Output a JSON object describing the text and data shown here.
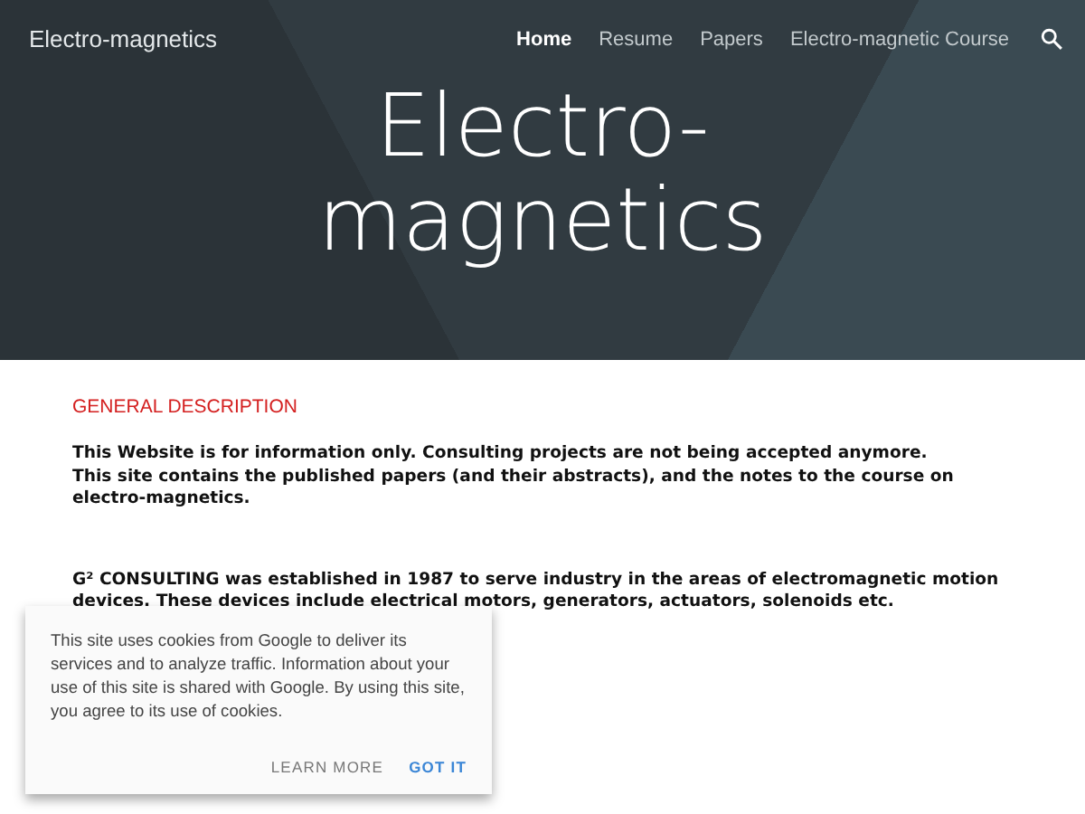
{
  "site_title": "Electro-magnetics",
  "nav": [
    {
      "label": "Home",
      "selected": true
    },
    {
      "label": "Resume",
      "selected": false
    },
    {
      "label": "Papers",
      "selected": false
    },
    {
      "label": "Electro-magnetic Course",
      "selected": false
    }
  ],
  "hero_title": "Electro-\nmagnetics",
  "section_heading": "GENERAL DESCRIPTION",
  "paragraphs": [
    {
      "lines": [
        "This Website is for information only. Consulting projects are not being accepted anymore.",
        "This site contains the published papers (and their abstracts), and the notes to the course on electro-magnetics."
      ]
    },
    {
      "lines": [
        "G² CONSULTING was established in 1987 to serve industry in the areas of electromagnetic motion devices. These devices include electrical motors, generators, actuators, solenoids etc."
      ]
    }
  ],
  "cookie_notice": {
    "text": "This site uses cookies from Google to deliver its services and to analyze traffic. Information about your use of this site is shared with Google. By using this site, you agree to its use of cookies.",
    "buttons": [
      {
        "label": "LEARN MORE",
        "kind": "secondary"
      },
      {
        "label": "GOT IT",
        "kind": "primary"
      }
    ]
  }
}
